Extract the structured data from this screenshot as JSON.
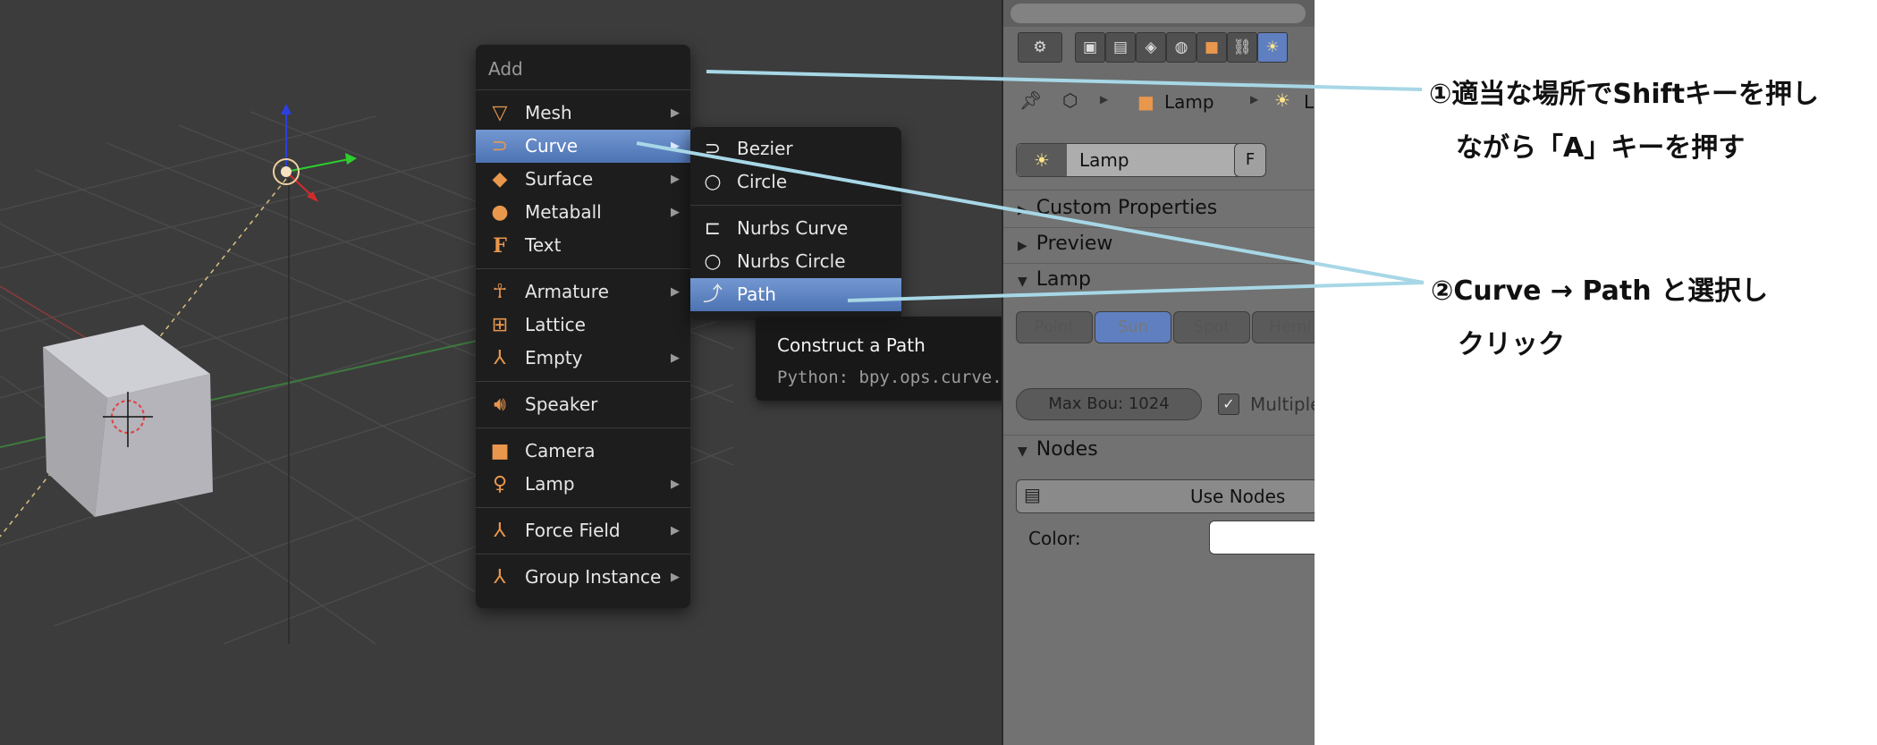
{
  "add_menu": {
    "title": "Add",
    "items": [
      {
        "label": "Mesh",
        "icon": "mesh-icon",
        "submenu": true
      },
      {
        "label": "Curve",
        "icon": "curve-icon",
        "submenu": true,
        "highlighted": true
      },
      {
        "label": "Surface",
        "icon": "surface-icon",
        "submenu": true
      },
      {
        "label": "Metaball",
        "icon": "metaball-icon",
        "submenu": true
      },
      {
        "label": "Text",
        "icon": "text-icon",
        "submenu": false
      },
      {
        "label": "Armature",
        "icon": "armature-icon",
        "submenu": true
      },
      {
        "label": "Lattice",
        "icon": "lattice-icon",
        "submenu": false
      },
      {
        "label": "Empty",
        "icon": "empty-icon",
        "submenu": true
      },
      {
        "label": "Speaker",
        "icon": "speaker-icon",
        "submenu": false
      },
      {
        "label": "Camera",
        "icon": "camera-icon",
        "submenu": false
      },
      {
        "label": "Lamp",
        "icon": "lamp-icon",
        "submenu": true
      },
      {
        "label": "Force Field",
        "icon": "force-field-icon",
        "submenu": true
      },
      {
        "label": "Group Instance",
        "icon": "group-instance-icon",
        "submenu": true
      }
    ]
  },
  "curve_submenu": {
    "items": [
      {
        "label": "Bezier",
        "icon": "bezier-icon"
      },
      {
        "label": "Circle",
        "icon": "circle-icon"
      },
      {
        "label": "Nurbs Curve",
        "icon": "nurbs-curve-icon"
      },
      {
        "label": "Nurbs Circle",
        "icon": "nurbs-circle-icon"
      },
      {
        "label": "Path",
        "icon": "path-icon",
        "highlighted": true
      }
    ]
  },
  "tooltip": {
    "title": "Construct a Path",
    "python": "Python: bpy.ops.curve.primitive_nurbs_path_add()"
  },
  "properties": {
    "breadcrumb": [
      "Lamp",
      "La"
    ],
    "datablock_name": "Lamp",
    "datablock_fake_user": "F",
    "panels": {
      "custom_properties": "Custom Properties",
      "preview": "Preview",
      "lamp": "Lamp",
      "nodes": "Nodes"
    },
    "lamp_types": [
      "Point",
      "Sun",
      "Spot",
      "Hemi"
    ],
    "max_bounces": "Max Bou:  1024",
    "multiple": "Multiple",
    "use_nodes": "Use Nodes",
    "color_label": "Color:"
  },
  "annotations": {
    "step1_line1": "①適当な場所でShiftキーを押し",
    "step1_line2": "ながら「A」キーを押す",
    "step2_line1": "②Curve → Path と選択し",
    "step2_line2": "クリック"
  },
  "colors": {
    "viewport_bg": "#3c3c3c",
    "menu_bg": "#1d1d1d",
    "highlight": "#5b80c0",
    "icon_orange": "#e8974d",
    "callout_line": "#a7d7e6"
  }
}
